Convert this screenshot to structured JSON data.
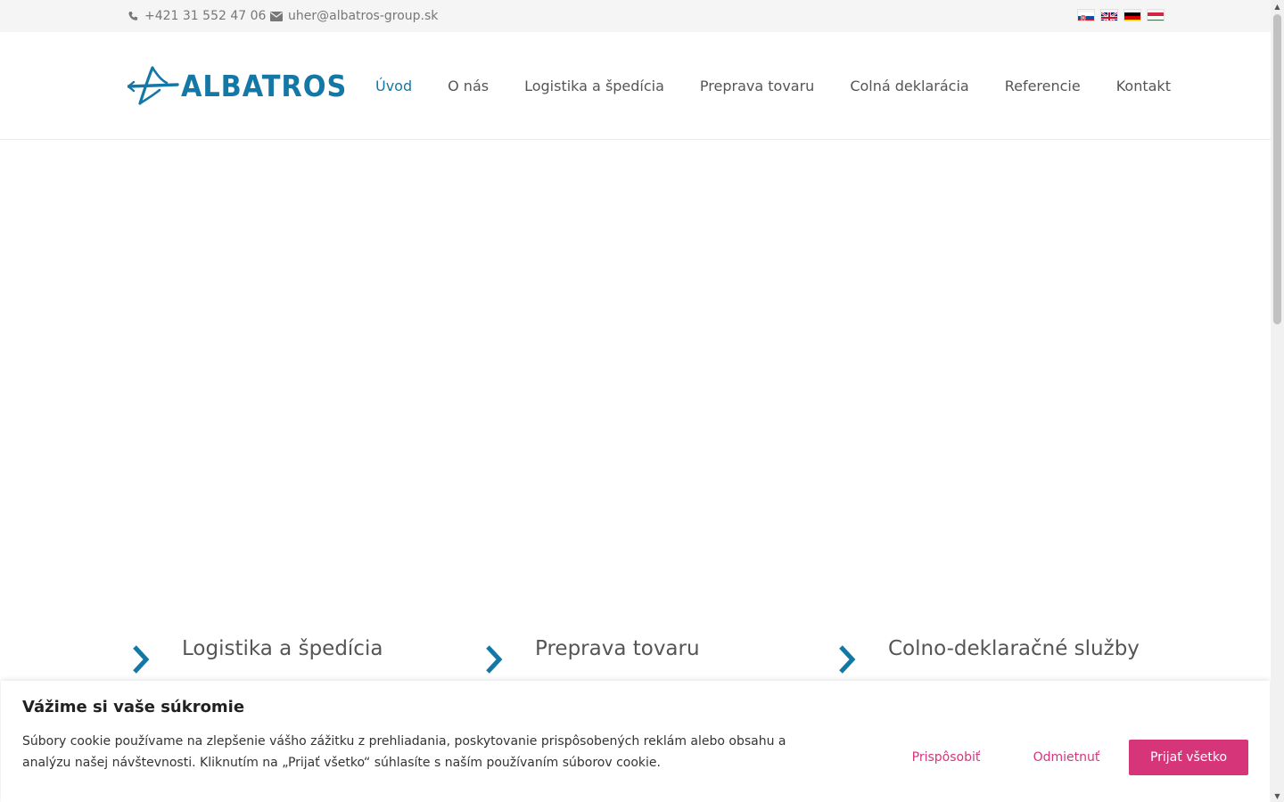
{
  "topbar": {
    "phone": "+421 31 552 47 06",
    "phone_icon": "phone-icon",
    "email": "uher@albatros-group.sk",
    "email_icon": "envelope-icon",
    "languages": [
      "Slovenčina",
      "English",
      "Deutsch",
      "Magyar"
    ]
  },
  "header": {
    "logo_text": "ALBATROS",
    "nav": [
      {
        "label": "Úvod",
        "active": true
      },
      {
        "label": "O nás"
      },
      {
        "label": "Logistika a špedícia"
      },
      {
        "label": "Preprava tovaru"
      },
      {
        "label": "Colná deklarácia"
      },
      {
        "label": "Referencie"
      },
      {
        "label": "Kontakt"
      }
    ]
  },
  "features": [
    {
      "title": "Logistika a špedícia",
      "icon": "chevron-right-icon"
    },
    {
      "title": "Preprava tovaru",
      "icon": "chevron-right-icon"
    },
    {
      "title": "Colno-deklaračné služby",
      "icon": "chevron-right-icon"
    }
  ],
  "cookie": {
    "title": "Vážime si vaše súkromie",
    "text": "Súbory cookie používame na zlepšenie vášho zážitku z prehliadania, poskytovanie prispôsobených reklám alebo obsahu a analýzu našej návštevnosti. Kliknutím na „Prijať všetko“ súhlasíte s naším používaním súborov cookie.",
    "customize": "Prispôsobiť",
    "reject": "Odmietnuť",
    "accept": "Prijať všetko"
  },
  "colors": {
    "brand_blue": "#1478a6",
    "cookie_accent": "#d6357a",
    "topbar_bg": "#f5f5f5"
  }
}
